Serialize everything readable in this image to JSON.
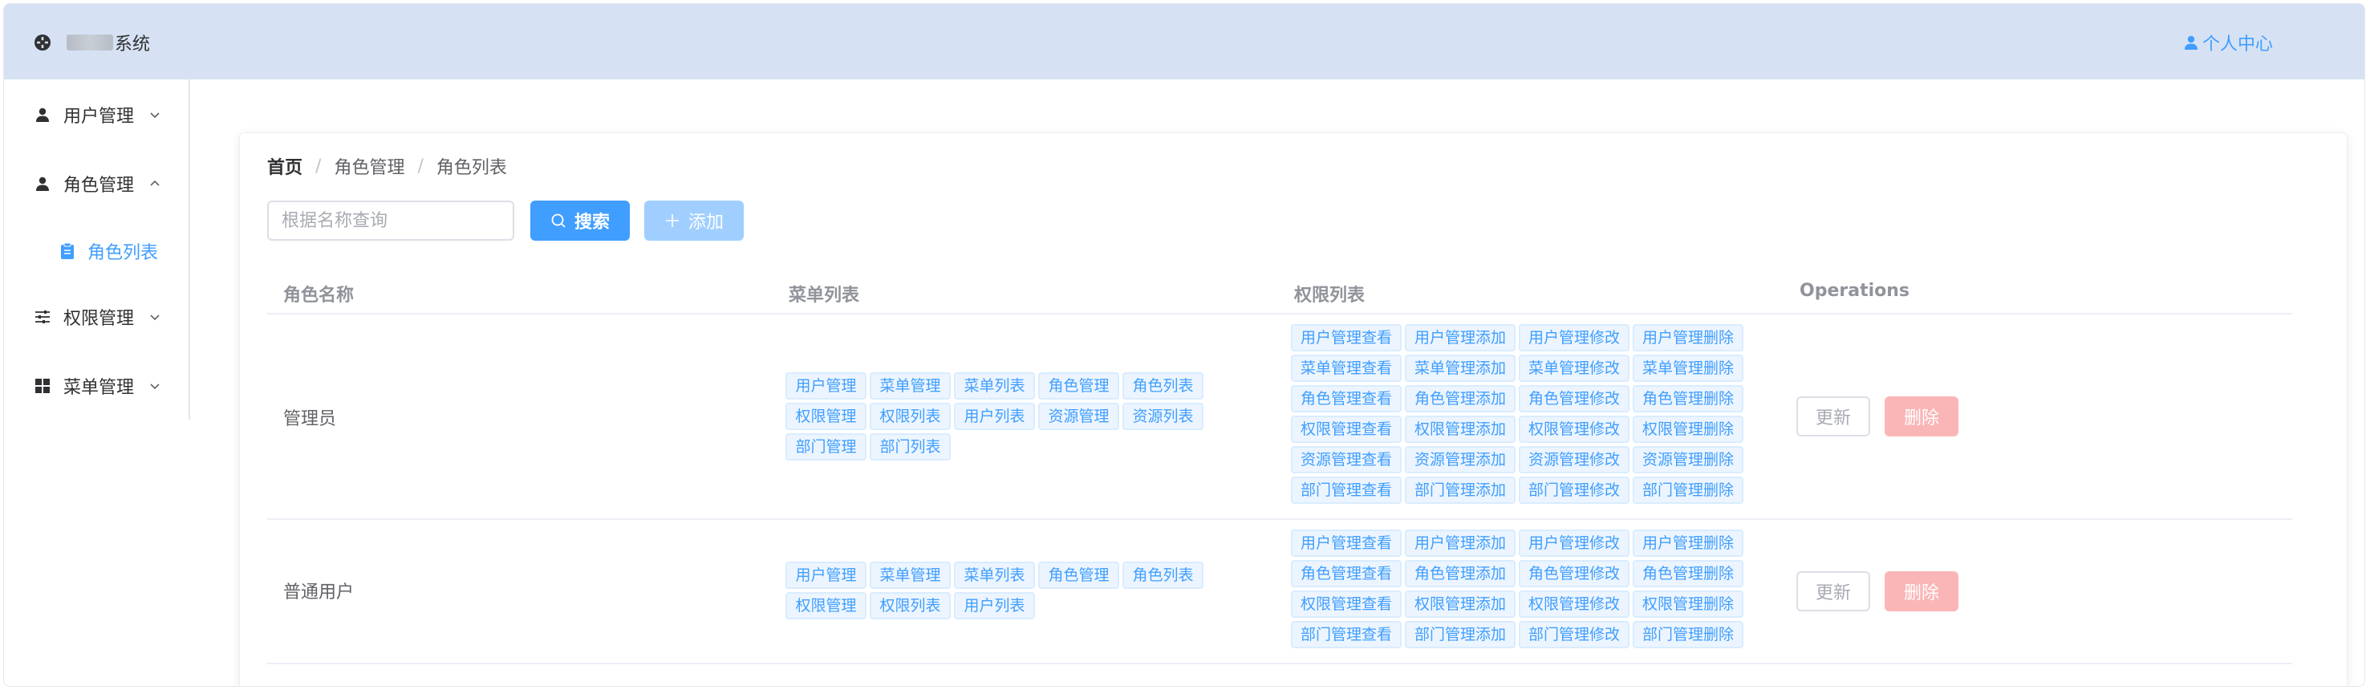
{
  "header": {
    "brand_suffix": "系统",
    "user_center": "个人中心"
  },
  "sidebar": {
    "items": [
      {
        "label": "用户管理",
        "icon": "user-icon",
        "expanded": false
      },
      {
        "label": "角色管理",
        "icon": "user-icon",
        "expanded": true,
        "children": [
          {
            "label": "角色列表",
            "icon": "clipboard-icon",
            "active": true
          }
        ]
      },
      {
        "label": "权限管理",
        "icon": "sliders-icon",
        "expanded": false
      },
      {
        "label": "菜单管理",
        "icon": "grid-icon",
        "expanded": false
      }
    ]
  },
  "breadcrumb": [
    "首页",
    "角色管理",
    "角色列表"
  ],
  "search": {
    "placeholder": "根据名称查询",
    "value": "",
    "search_label": "搜索",
    "add_label": "添加"
  },
  "table": {
    "headers": [
      "角色名称",
      "菜单列表",
      "权限列表",
      "Operations"
    ],
    "rows": [
      {
        "name": "管理员",
        "menus": [
          "用户管理",
          "菜单管理",
          "菜单列表",
          "角色管理",
          "角色列表",
          "权限管理",
          "权限列表",
          "用户列表",
          "资源管理",
          "资源列表",
          "部门管理",
          "部门列表"
        ],
        "permissions": [
          "用户管理查看",
          "用户管理添加",
          "用户管理修改",
          "用户管理删除",
          "菜单管理查看",
          "菜单管理添加",
          "菜单管理修改",
          "菜单管理删除",
          "角色管理查看",
          "角色管理添加",
          "角色管理修改",
          "角色管理删除",
          "权限管理查看",
          "权限管理添加",
          "权限管理修改",
          "权限管理删除",
          "资源管理查看",
          "资源管理添加",
          "资源管理修改",
          "资源管理删除",
          "部门管理查看",
          "部门管理添加",
          "部门管理修改",
          "部门管理删除"
        ],
        "update_label": "更新",
        "delete_label": "删除"
      },
      {
        "name": "普通用户",
        "menus": [
          "用户管理",
          "菜单管理",
          "菜单列表",
          "角色管理",
          "角色列表",
          "权限管理",
          "权限列表",
          "用户列表"
        ],
        "permissions": [
          "用户管理查看",
          "用户管理添加",
          "用户管理修改",
          "用户管理删除",
          "角色管理查看",
          "角色管理添加",
          "角色管理修改",
          "角色管理删除",
          "权限管理查看",
          "权限管理添加",
          "权限管理修改",
          "权限管理删除",
          "部门管理查看",
          "部门管理添加",
          "部门管理修改",
          "部门管理删除"
        ],
        "update_label": "更新",
        "delete_label": "删除"
      }
    ]
  },
  "colors": {
    "header_bg": "#d6e2f4",
    "primary": "#409eff",
    "primary_disabled": "#a0cfff",
    "danger_disabled": "#fab6b6",
    "tag_bg": "#ecf5ff"
  }
}
